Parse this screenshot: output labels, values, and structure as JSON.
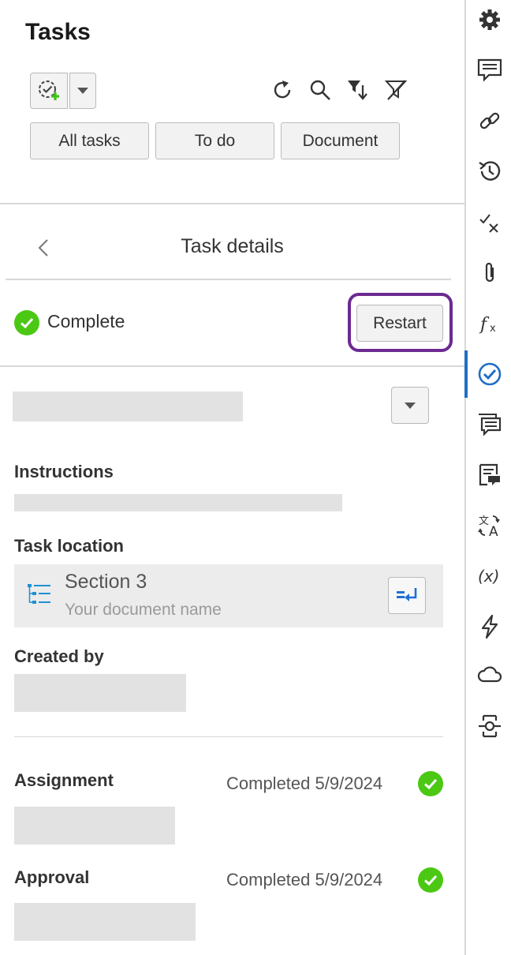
{
  "panel": {
    "title": "Tasks"
  },
  "filters": [
    "All tasks",
    "To do",
    "Document"
  ],
  "details": {
    "title": "Task details"
  },
  "status": {
    "text": "Complete",
    "restart_label": "Restart"
  },
  "sections": {
    "instructions": "Instructions",
    "task_location": "Task location",
    "created_by": "Created by",
    "assignment": "Assignment",
    "approval": "Approval"
  },
  "location": {
    "section": "Section 3",
    "document": "Your document name"
  },
  "assignment": {
    "status": "Completed",
    "date": "5/9/2024"
  },
  "approval": {
    "status": "Completed",
    "date": "5/9/2024"
  },
  "rail": {
    "icons": [
      "gear-icon",
      "comment-icon",
      "link-icon",
      "history-icon",
      "check-x-icon",
      "paperclip-icon",
      "function-icon",
      "tasks-icon",
      "messages-icon",
      "document-comment-icon",
      "translate-icon",
      "variable-icon",
      "lightning-icon",
      "cloud-icon",
      "connector-icon"
    ],
    "active": "tasks-icon"
  },
  "colors": {
    "success": "#4bc813",
    "focus": "#6c2a91",
    "active": "#1f6fc5",
    "placeholder": "#e2e2e2"
  }
}
